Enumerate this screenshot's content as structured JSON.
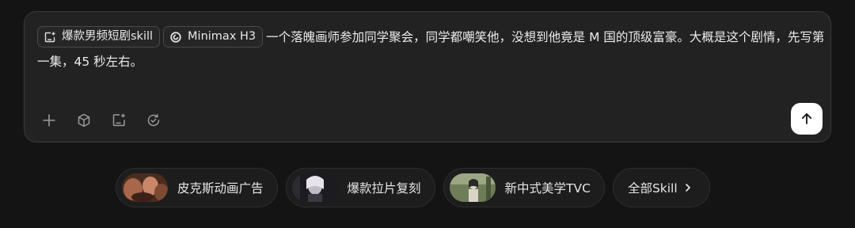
{
  "composer": {
    "chips": [
      {
        "label": "爆款男频短剧skill",
        "icon": "skill-add-icon"
      },
      {
        "label": "Minimax H3",
        "icon": "minimax-logo-icon"
      }
    ],
    "prompt_text": "一个落魄画师参加同学聚会，同学都嘲笑他，没想到他竟是 M 国的顶级富豪。大概是这个剧情，先写第一集，45 秒左右。",
    "tools": [
      "plus-icon",
      "cube-icon",
      "skill-add-icon",
      "refresh-check-icon"
    ],
    "send_icon": "arrow-up-icon"
  },
  "suggestions": [
    {
      "label": "皮克斯动画广告",
      "thumb_colors": [
        "#6b3f2a",
        "#c9876a",
        "#3a2218"
      ]
    },
    {
      "label": "爆款拉片复刻",
      "thumb_colors": [
        "#2a2a30",
        "#bfbcc6",
        "#151518"
      ]
    },
    {
      "label": "新中式美学TVC",
      "thumb_colors": [
        "#5d6b4a",
        "#d9d4c8",
        "#2f3a26"
      ]
    },
    {
      "label": "全部Skill",
      "icon": "chevron-right-icon"
    }
  ],
  "colors": {
    "background": "#141414",
    "composer_bg": "#222222",
    "send_button": "#ffffff"
  }
}
